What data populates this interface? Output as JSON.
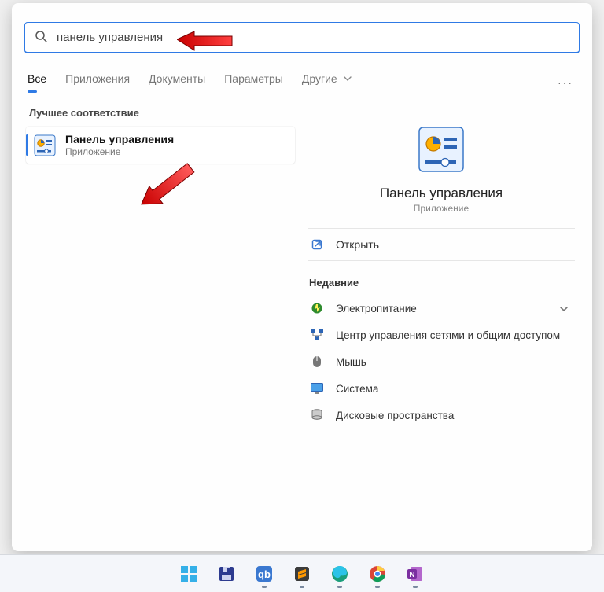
{
  "search": {
    "value": "панель управления"
  },
  "tabs": {
    "items": [
      "Все",
      "Приложения",
      "Документы",
      "Параметры"
    ],
    "more_label": "Другие",
    "active_index": 0
  },
  "left": {
    "section_label": "Лучшее соответствие",
    "result": {
      "title": "Панель управления",
      "subtitle": "Приложение",
      "icon": "control-panel-icon"
    }
  },
  "right": {
    "hero": {
      "title": "Панель управления",
      "subtitle": "Приложение",
      "icon": "control-panel-icon"
    },
    "open_label": "Открыть",
    "recent_label": "Недавние",
    "recent_items": [
      {
        "label": "Электропитание",
        "icon": "power-icon"
      },
      {
        "label": "Центр управления сетями и общим доступом",
        "icon": "network-center-icon"
      },
      {
        "label": "Мышь",
        "icon": "mouse-icon"
      },
      {
        "label": "Система",
        "icon": "system-icon"
      },
      {
        "label": "Дисковые пространства",
        "icon": "disk-spaces-icon"
      }
    ]
  },
  "taskbar": {
    "items": [
      {
        "icon": "start-icon",
        "running": false
      },
      {
        "icon": "save-disk-icon",
        "running": false
      },
      {
        "icon": "qbittorrent-icon",
        "running": true
      },
      {
        "icon": "sublime-icon",
        "running": true
      },
      {
        "icon": "edge-icon",
        "running": true
      },
      {
        "icon": "chrome-icon",
        "running": true
      },
      {
        "icon": "onenote-icon",
        "running": true
      }
    ]
  }
}
